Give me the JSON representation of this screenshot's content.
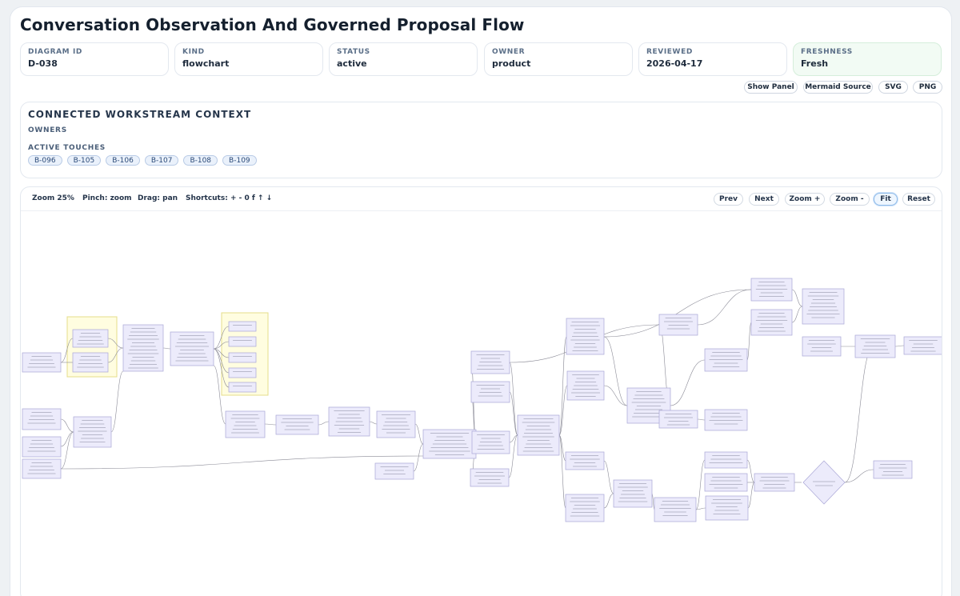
{
  "title": "Conversation Observation And Governed Proposal Flow",
  "meta": [
    {
      "label": "DIAGRAM ID",
      "value": "D-038"
    },
    {
      "label": "KIND",
      "value": "flowchart"
    },
    {
      "label": "STATUS",
      "value": "active"
    },
    {
      "label": "OWNER",
      "value": "product"
    },
    {
      "label": "REVIEWED",
      "value": "2026-04-17"
    },
    {
      "label": "FRESHNESS",
      "value": "Fresh"
    }
  ],
  "actions": {
    "show_panel": "Show Panel",
    "mermaid_source": "Mermaid Source",
    "svg": "SVG",
    "png": "PNG"
  },
  "context": {
    "title": "CONNECTED WORKSTREAM CONTEXT",
    "owners_label": "OWNERS",
    "touches_label": "ACTIVE TOUCHES",
    "touches": [
      "B-096",
      "B-105",
      "B-106",
      "B-107",
      "B-108",
      "B-109"
    ]
  },
  "viewer": {
    "zoom": "Zoom 25%",
    "pinch": "Pinch: zoom",
    "drag": "Drag: pan",
    "shortcuts": "Shortcuts: + - 0 f ↑ ↓",
    "prev": "Prev",
    "next": "Next",
    "zoom_in": "Zoom +",
    "zoom_out": "Zoom -",
    "fit": "Fit",
    "reset": "Reset"
  },
  "colors": {
    "node_fill": "#ecebfb",
    "node_stroke": "#a9a6d6",
    "group_fill": "#fffde0",
    "group_stroke": "#e4dd8a",
    "edge": "#8a8a96",
    "fresh_bg": "#f2fbf4",
    "chip_bg": "#eaf1fb"
  }
}
